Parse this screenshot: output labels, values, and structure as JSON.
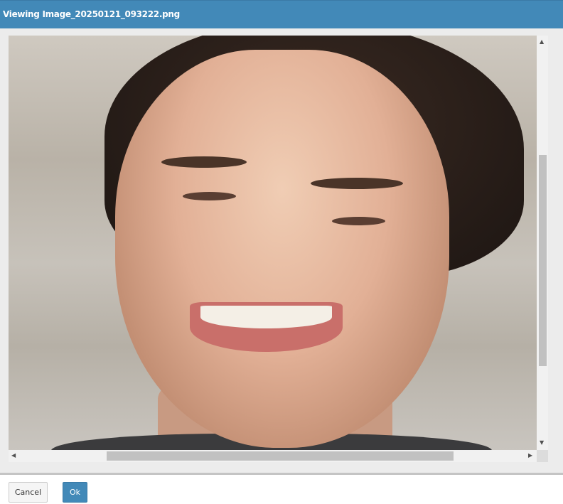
{
  "dialog": {
    "title": "Viewing Image_20250121_093222.png",
    "image_description_icon": "photo-portrait",
    "vertical_scroll_fraction": 0.29,
    "horizontal_scroll_fraction": 0.22
  },
  "footer": {
    "cancel_label": "Cancel",
    "ok_label": "Ok"
  },
  "colors": {
    "accent": "#4289b8"
  }
}
